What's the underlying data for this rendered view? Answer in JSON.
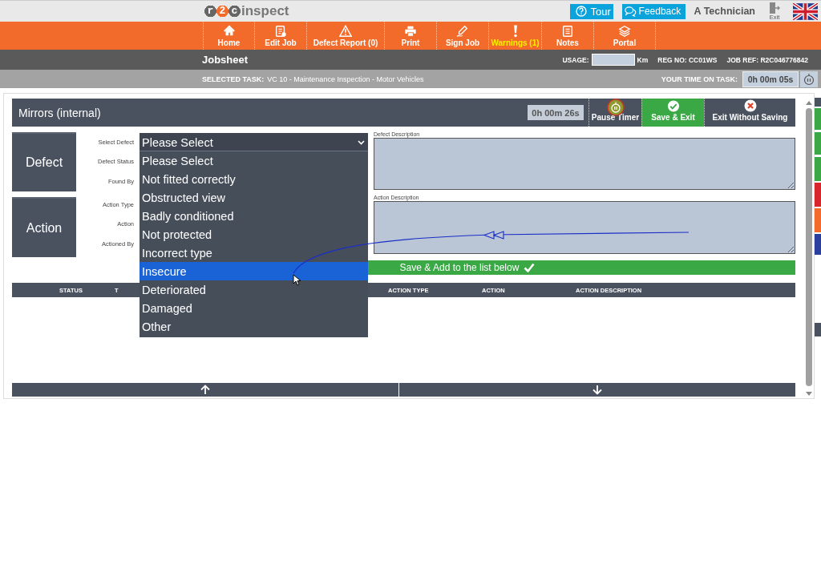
{
  "header": {
    "logo_mark": "r2c",
    "logo_text": "inspect",
    "tour_button": "Tour",
    "feedback_button": "Feedback",
    "user": "A Technician",
    "exit_label": "Exit"
  },
  "nav": [
    {
      "label": "Home",
      "highlighted": false
    },
    {
      "label": "Edit Job",
      "highlighted": false
    },
    {
      "label": "Defect Report (0)",
      "highlighted": false
    },
    {
      "label": "Print",
      "highlighted": false
    },
    {
      "label": "Sign Job",
      "highlighted": false
    },
    {
      "label": "Warnings (1)",
      "highlighted": true
    },
    {
      "label": "Notes",
      "highlighted": false
    },
    {
      "label": "Portal",
      "highlighted": false
    }
  ],
  "jobsheet": {
    "title": "Jobsheet",
    "usage_label": "USAGE:",
    "usage_unit": "Km",
    "reg_no": "REG NO: CC01WS",
    "job_ref": "JOB REF: R2C046776842"
  },
  "task_bar": {
    "label": "SELECTED TASK:",
    "task": "VC 10 - Maintenance Inspection - Motor Vehicles",
    "time_label": "YOUR TIME ON TASK:",
    "time": "0h 00m 05s"
  },
  "editor": {
    "title": "Mirrors (internal)",
    "timer": "0h 00m 26s",
    "pause_button": "Pause Timer",
    "save_exit_button": "Save & Exit",
    "exit_button": "Exit Without Saving",
    "sections": [
      {
        "title": "Defect",
        "fields": [
          "Select Defect",
          "Defect Status",
          "Found By"
        ]
      },
      {
        "title": "Action",
        "fields": [
          "Action Type",
          "Action",
          "Actioned By"
        ]
      }
    ],
    "select": {
      "value": "Please Select",
      "expanded": true,
      "options": [
        {
          "label": "Please Select",
          "highlighted": false
        },
        {
          "label": "Not fitted correctly",
          "highlighted": false
        },
        {
          "label": "Obstructed view",
          "highlighted": false
        },
        {
          "label": "Badly conditioned",
          "highlighted": false
        },
        {
          "label": "Not protected",
          "highlighted": false
        },
        {
          "label": "Incorrect type",
          "highlighted": false
        },
        {
          "label": "Insecure",
          "highlighted": true
        },
        {
          "label": "Deteriorated",
          "highlighted": false
        },
        {
          "label": "Damaged",
          "highlighted": false
        },
        {
          "label": "Other",
          "highlighted": false
        }
      ]
    },
    "defect_description_label": "Defect Description",
    "action_description_label": "Action Description",
    "add_button": "Save & Add to the list below",
    "table": {
      "columns": [
        "STATUS",
        "T",
        "ACTION TYPE",
        "ACTION",
        "ACTION DESCRIPTION"
      ]
    }
  },
  "side_tabs": [
    {
      "color": "#4a5260"
    },
    {
      "color": "#3aa845"
    },
    {
      "color": "#3aa845"
    },
    {
      "color": "#3aa845"
    },
    {
      "color": "#d9262c"
    },
    {
      "color": "#f26b2a"
    },
    {
      "color": "#2b3f9e"
    },
    {
      "color": "#4a5260"
    }
  ]
}
